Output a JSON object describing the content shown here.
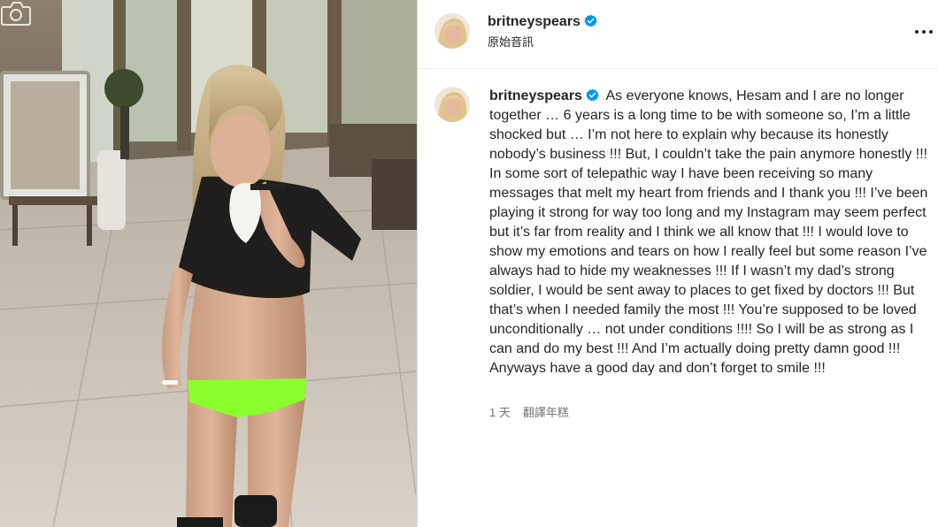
{
  "post": {
    "username": "britneyspears",
    "audio_label": "原始音訊",
    "caption": "As everyone knows, Hesam and I are no longer together … 6 years is a long time to be with someone so, I’m a little shocked but … I’m not here to explain why because its honestly nobody’s business !!! But, I couldn’t take the pain anymore honestly !!! In some sort of telepathic way I have been receiving so many messages that melt my heart from friends and I thank you !!! I’ve been playing it strong for way too long and my Instagram may seem perfect but it’s far from reality and I think we all know that !!! I would love to show my emotions and tears on how I really feel but some reason I’ve always had to hide my weaknesses !!! If I wasn’t my dad’s strong soldier, I would be sent away to places to get fixed by doctors !!! But that’s when I needed family the most !!! You’re supposed to be loved unconditionally … not under conditions !!!! So I will be as strong as I can and do my best !!! And I’m actually doing pretty damn good !!! Anyways have a good day and don’t forget to smile !!!",
    "time_ago": "1 天",
    "translate_label": "翻譯年糕"
  },
  "icons": {
    "camera": "camera-icon",
    "verified": "verified-badge-icon",
    "more": "more-options-icon"
  },
  "colors": {
    "verified": "#0095f6",
    "text": "#262626",
    "secondary": "#737373"
  }
}
